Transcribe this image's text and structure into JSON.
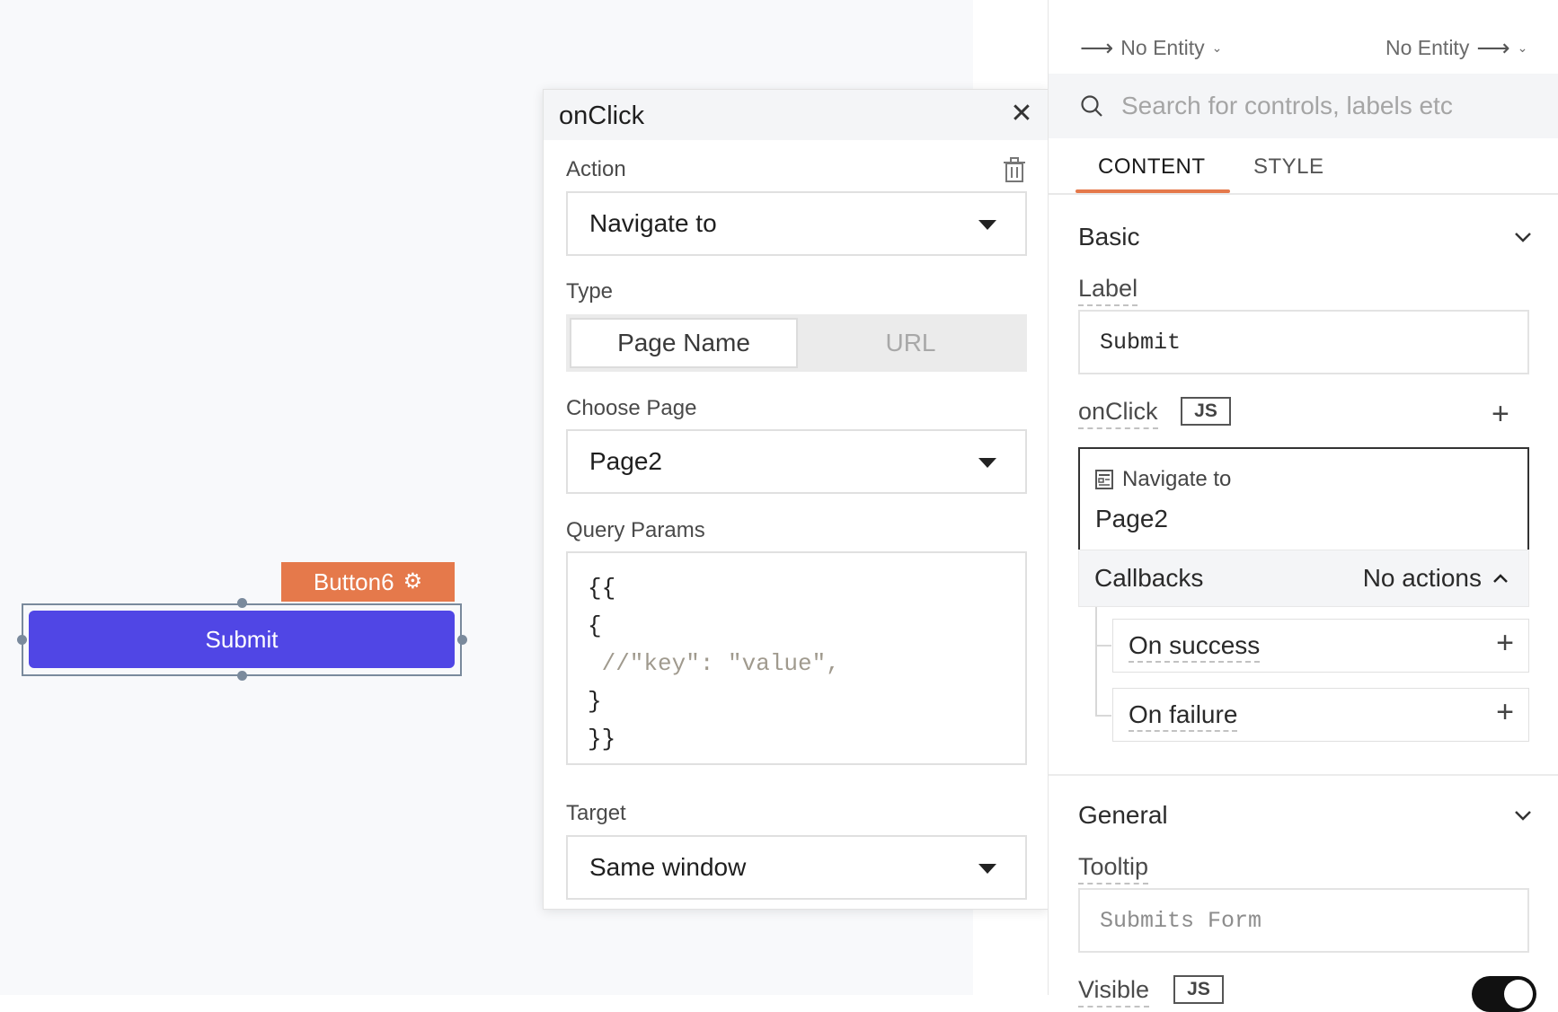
{
  "canvas": {
    "widget_name": "Button6",
    "widget_button_label": "Submit"
  },
  "popup": {
    "title": "onClick",
    "action": {
      "label": "Action",
      "value": "Navigate to"
    },
    "type": {
      "label": "Type",
      "options": [
        "Page Name",
        "URL"
      ],
      "selected": "Page Name"
    },
    "choose_page": {
      "label": "Choose Page",
      "value": "Page2"
    },
    "query_params": {
      "label": "Query Params",
      "lines": [
        "{{",
        "{",
        " //\"key\": \"value\",",
        "}",
        "}}"
      ]
    },
    "target": {
      "label": "Target",
      "value": "Same window"
    }
  },
  "panel": {
    "entity_left": "No Entity",
    "entity_right": "No Entity",
    "search": {
      "placeholder": "Search for controls, labels etc"
    },
    "tabs": [
      {
        "label": "CONTENT",
        "active": true
      },
      {
        "label": "STYLE",
        "active": false
      }
    ],
    "basic": {
      "title": "Basic",
      "label_prop": {
        "label": "Label",
        "value": "Submit"
      },
      "onclick_prop": {
        "label": "onClick",
        "js_badge": "JS",
        "action_type": "Navigate to",
        "action_target": "Page2",
        "callbacks_label": "Callbacks",
        "callbacks_status": "No actions",
        "on_success": "On success",
        "on_failure": "On failure"
      }
    },
    "general": {
      "title": "General",
      "tooltip": {
        "label": "Tooltip",
        "placeholder": "Submits Form"
      },
      "visible": {
        "label": "Visible",
        "js_badge": "JS",
        "on": true
      }
    }
  },
  "colors": {
    "accent": "#e5794b",
    "button": "#5046e5",
    "canvas_bg": "#f8f9fb"
  }
}
